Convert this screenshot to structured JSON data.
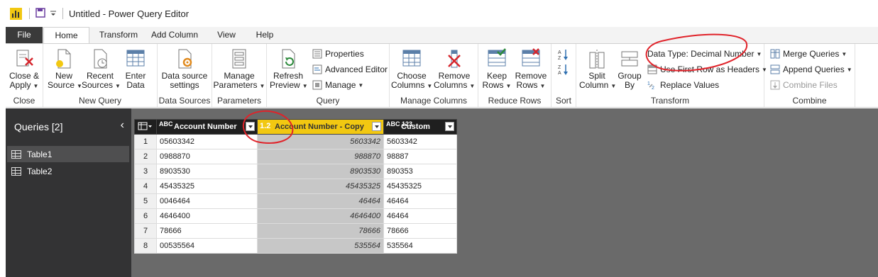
{
  "titlebar": {
    "title": "Untitled - Power Query Editor"
  },
  "tabs": [
    "File",
    "Home",
    "Transform",
    "Add Column",
    "View",
    "Help"
  ],
  "ribbon": {
    "close": {
      "button": [
        "Close &",
        "Apply"
      ],
      "group": "Close"
    },
    "new_query": {
      "new_source": [
        "New",
        "Source"
      ],
      "recent_sources": [
        "Recent",
        "Sources"
      ],
      "enter_data": [
        "Enter",
        "Data"
      ],
      "group": "New Query"
    },
    "data_sources": {
      "settings": [
        "Data source",
        "settings"
      ],
      "group": "Data Sources"
    },
    "parameters": {
      "manage": [
        "Manage",
        "Parameters"
      ],
      "group": "Parameters"
    },
    "query": {
      "refresh": [
        "Refresh",
        "Preview"
      ],
      "properties": "Properties",
      "advanced_editor": "Advanced Editor",
      "manage": "Manage",
      "group": "Query"
    },
    "manage_columns": {
      "choose": [
        "Choose",
        "Columns"
      ],
      "remove": [
        "Remove",
        "Columns"
      ],
      "group": "Manage Columns"
    },
    "reduce_rows": {
      "keep": [
        "Keep",
        "Rows"
      ],
      "remove": [
        "Remove",
        "Rows"
      ],
      "group": "Reduce Rows"
    },
    "sort": {
      "group": "Sort"
    },
    "transform": {
      "split": [
        "Split",
        "Column"
      ],
      "group_by": [
        "Group",
        "By"
      ],
      "data_type": "Data Type: Decimal Number",
      "first_row": "Use First Row as Headers",
      "replace": "Replace Values",
      "group": "Transform"
    },
    "combine": {
      "merge": "Merge Queries",
      "append": "Append Queries",
      "combine_files": "Combine Files",
      "group": "Combine"
    }
  },
  "queries": {
    "header": "Queries [2]",
    "items": [
      "Table1",
      "Table2"
    ]
  },
  "table": {
    "columns": [
      {
        "type": "ABC",
        "name": "Account Number"
      },
      {
        "type": "1.2",
        "name": "Account Number - Copy"
      },
      {
        "type": "ABC 123",
        "name": "Custom"
      }
    ],
    "rows": [
      [
        "1",
        "05603342",
        "5603342",
        "5603342"
      ],
      [
        "2",
        "0988870",
        "988870",
        "98887"
      ],
      [
        "3",
        "8903530",
        "8903530",
        "890353"
      ],
      [
        "4",
        "45435325",
        "45435325",
        "45435325"
      ],
      [
        "5",
        "0046464",
        "46464",
        "46464"
      ],
      [
        "6",
        "4646400",
        "4646400",
        "46464"
      ],
      [
        "7",
        "78666",
        "78666",
        "78666"
      ],
      [
        "8",
        "00535564",
        "535564",
        "535564"
      ]
    ]
  },
  "colors": {
    "accent": "#f2c811",
    "annotation": "#e0232a",
    "file_tab": "#3a3a3a",
    "pane": "#333334"
  }
}
